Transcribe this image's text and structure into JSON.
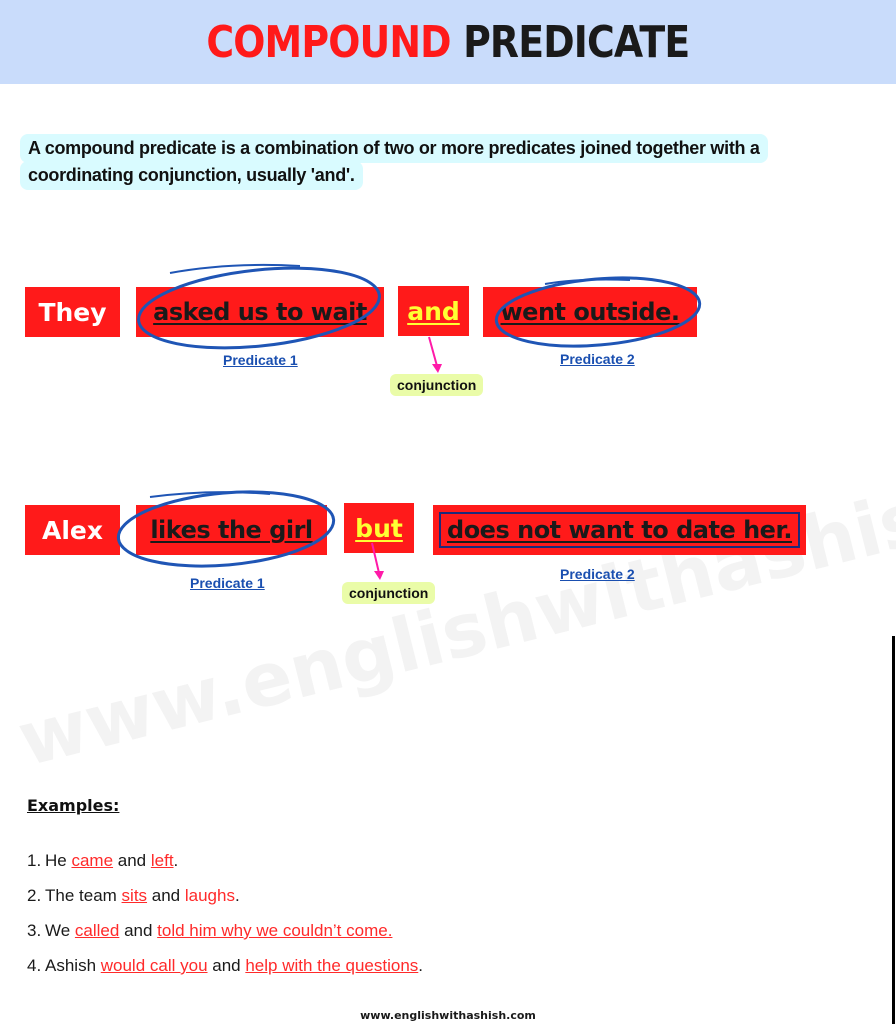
{
  "header": {
    "title_part1": "COMPOUND",
    "title_part2": "PREDICATE",
    "background_color": "#c9dcfb",
    "accent_color": "#ff1a1a"
  },
  "definition": {
    "line1": "A compound predicate is a combination of two or more predicates joined together with a",
    "line2": "coordinating conjunction, usually 'and'."
  },
  "diagrams": [
    {
      "subject": "They",
      "predicate1": "asked us to wait",
      "conjunction": "and",
      "predicate2": "went outside.",
      "predicate1_label": "Predicate 1",
      "predicate2_label": "Predicate 2",
      "conjunction_label": "conjunction"
    },
    {
      "subject": "Alex",
      "predicate1": "likes the girl",
      "conjunction": "but",
      "predicate2": "does not want to date her.",
      "predicate1_label": "Predicate 1",
      "predicate2_label": "Predicate 2",
      "conjunction_label": "conjunction"
    }
  ],
  "watermark": "www.englishwithashish.com",
  "examples": {
    "title": "Examples:",
    "items": [
      {
        "num": "1.",
        "parts": [
          "He ",
          "came",
          " and ",
          "left",
          "."
        ]
      },
      {
        "num": "2.",
        "parts": [
          "The team ",
          "sits",
          " and ",
          "laughs",
          "."
        ]
      },
      {
        "num": "3.",
        "parts": [
          "We ",
          "called",
          " and ",
          "told him why we couldn’t come.",
          ""
        ]
      },
      {
        "num": "4.",
        "parts": [
          "Ashish ",
          "would call you",
          " and ",
          "help with the questions",
          "."
        ]
      }
    ]
  },
  "footer": "www.englishwithashish.com"
}
